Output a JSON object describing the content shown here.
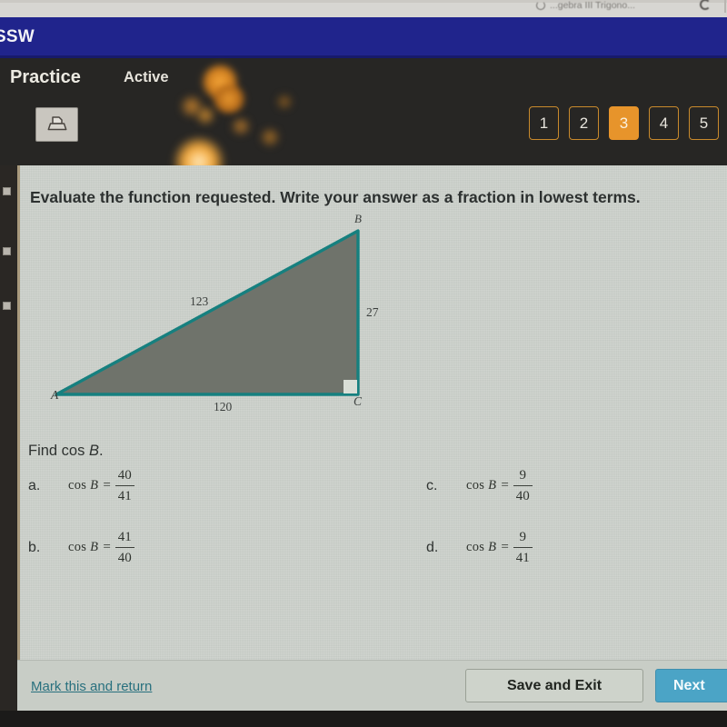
{
  "browser": {
    "tab_title": "...gebra III Trigono...",
    "favicon": "circle-icon",
    "refresh": "refresh-icon"
  },
  "app_bar": {
    "brand": "SSW",
    "color": "#20248c"
  },
  "quiz_header": {
    "section_label": "Practice",
    "status_label": "Active",
    "print_icon": "printer-icon",
    "accent_color": "#e7942b",
    "question_buttons": [
      {
        "label": "1",
        "current": false
      },
      {
        "label": "2",
        "current": false
      },
      {
        "label": "3",
        "current": true
      },
      {
        "label": "4",
        "current": false
      },
      {
        "label": "5",
        "current": false
      }
    ]
  },
  "question": {
    "prompt": "Evaluate the function requested. Write your answer as a fraction in lowest terms.",
    "find_prefix": "Find cos ",
    "find_variable": "B",
    "find_suffix": "."
  },
  "figure": {
    "type": "right-triangle",
    "vertex_a": "A",
    "vertex_b": "B",
    "vertex_c": "C",
    "hypotenuse_label": "123",
    "vertical_leg_label": "27",
    "base_label": "120",
    "right_angle_at": "C",
    "stroke_color": "#16807f",
    "fill_color": "#6f736b"
  },
  "options": [
    {
      "letter": "a.",
      "expr_prefix": "cos ",
      "expr_var": "B",
      "equals": "=",
      "numerator": "40",
      "denominator": "41"
    },
    {
      "letter": "b.",
      "expr_prefix": "cos ",
      "expr_var": "B",
      "equals": "=",
      "numerator": "41",
      "denominator": "40"
    },
    {
      "letter": "c.",
      "expr_prefix": "cos ",
      "expr_var": "B",
      "equals": "=",
      "numerator": "9",
      "denominator": "40"
    },
    {
      "letter": "d.",
      "expr_prefix": "cos ",
      "expr_var": "B",
      "equals": "=",
      "numerator": "9",
      "denominator": "41"
    }
  ],
  "footer": {
    "mark_return_label": "Mark this and return",
    "save_exit_label": "Save and Exit",
    "next_label": "Next",
    "next_color": "#4ba4c6",
    "link_color": "#28707e"
  }
}
